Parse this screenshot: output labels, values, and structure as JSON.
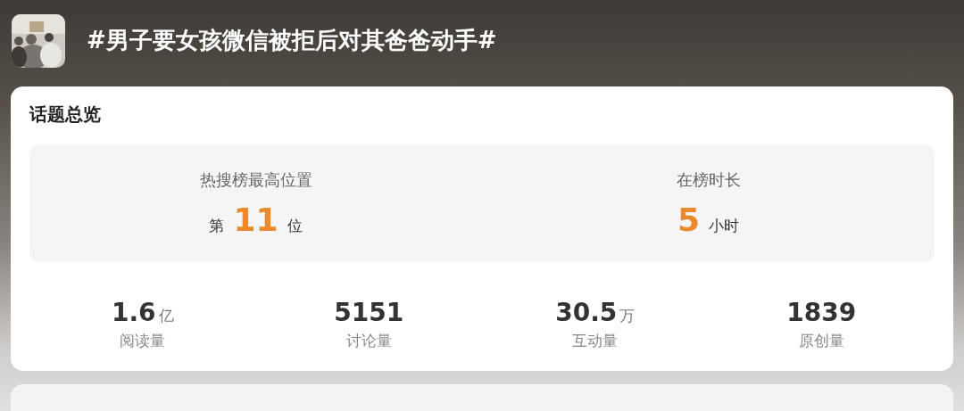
{
  "header": {
    "title": "#男子要女孩微信被拒后对其爸爸动手#"
  },
  "overview": {
    "title": "话题总览",
    "highlights": [
      {
        "label": "热搜榜最高位置",
        "prefix": "第",
        "value": "11",
        "suffix": "位"
      },
      {
        "label": "在榜时长",
        "value": "5",
        "suffix": "小时"
      }
    ],
    "stats": [
      {
        "value": "1.6",
        "unit": "亿",
        "label": "阅读量"
      },
      {
        "value": "5151",
        "label": "讨论量"
      },
      {
        "value": "30.5",
        "unit": "万",
        "label": "互动量"
      },
      {
        "value": "1839",
        "label": "原创量"
      }
    ]
  }
}
